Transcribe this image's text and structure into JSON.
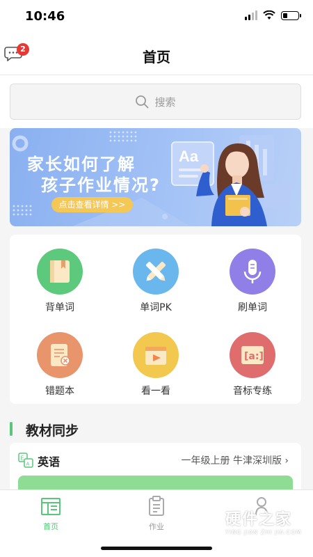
{
  "status_bar": {
    "time": "10:46"
  },
  "header": {
    "title": "首页",
    "message_badge": "2"
  },
  "search": {
    "placeholder": "搜索"
  },
  "banner": {
    "line1": "家长如何了解",
    "line2": "孩子作业情况?",
    "cta": "点击查看详情 >>"
  },
  "features": [
    {
      "label": "背单词",
      "color": "#5cc97c",
      "icon": "book-icon"
    },
    {
      "label": "单词PK",
      "color": "#6ab7ee",
      "icon": "crossed-pencils-icon"
    },
    {
      "label": "刷单词",
      "color": "#8f7fe6",
      "icon": "microphone-icon"
    },
    {
      "label": "错题本",
      "color": "#e8956b",
      "icon": "error-notebook-icon"
    },
    {
      "label": "看一看",
      "color": "#f2c84e",
      "icon": "video-icon"
    },
    {
      "label": "音标专练",
      "color": "#e06d6d",
      "icon": "phonetic-icon"
    }
  ],
  "section": {
    "title": "教材同步"
  },
  "textbook": {
    "subject": "英语",
    "grade": "一年级上册 牛津深圳版 ›"
  },
  "tabs": [
    {
      "label": "首页",
      "active": true,
      "icon": "home-icon"
    },
    {
      "label": "作业",
      "active": false,
      "icon": "clipboard-icon"
    },
    {
      "label": "",
      "active": false,
      "icon": "profile-icon"
    }
  ],
  "watermark": {
    "name": "硬件之家",
    "sub": "YING JIAN ZHI JIA.COM"
  },
  "colors": {
    "accent": "#58c77a",
    "badge": "#e53935",
    "banner_button": "#f5c755"
  }
}
